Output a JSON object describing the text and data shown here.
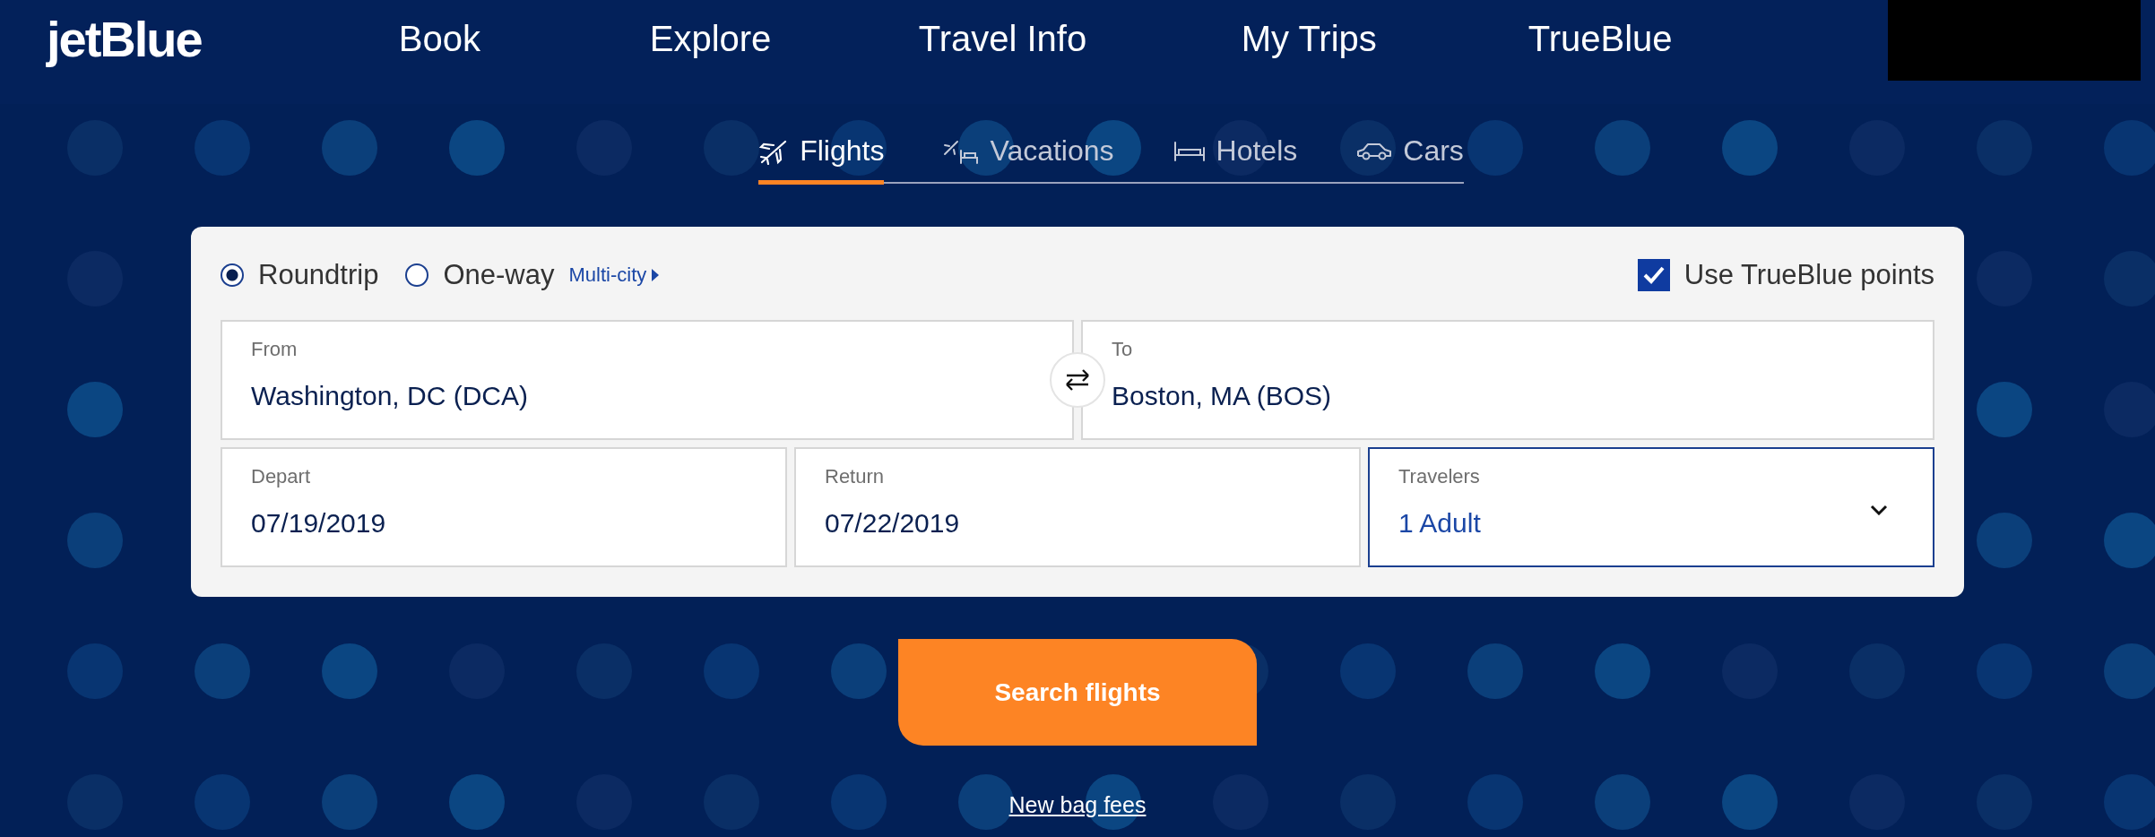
{
  "logo": "jetBlue",
  "nav": [
    "Book",
    "Explore",
    "Travel Info",
    "My Trips",
    "TrueBlue"
  ],
  "tabs": [
    {
      "label": "Flights",
      "kind": "flights",
      "selected": true
    },
    {
      "label": "Vacations",
      "kind": "vacations",
      "selected": false
    },
    {
      "label": "Hotels",
      "kind": "hotels",
      "selected": false
    },
    {
      "label": "Cars",
      "kind": "cars",
      "selected": false
    }
  ],
  "trip_types": [
    {
      "label": "Roundtrip",
      "selected": true
    },
    {
      "label": "One-way",
      "selected": false
    }
  ],
  "multi_city_link": "Multi-city",
  "points_checkbox": {
    "label": "Use TrueBlue points",
    "checked": true
  },
  "field_rows": [
    [
      {
        "label": "From",
        "value": "Washington, DC (DCA)",
        "kind": "text",
        "focused": false
      },
      {
        "label": "To",
        "value": "Boston, MA (BOS)",
        "kind": "text",
        "focused": false
      }
    ],
    [
      {
        "label": "Depart",
        "value": "07/19/2019",
        "kind": "text",
        "focused": false
      },
      {
        "label": "Return",
        "value": "07/22/2019",
        "kind": "text",
        "focused": false
      },
      {
        "label": "Travelers",
        "value": "1 Adult",
        "kind": "select",
        "focused": true
      }
    ]
  ],
  "search_button": "Search flights",
  "bag_fees_link": "New bag fees"
}
